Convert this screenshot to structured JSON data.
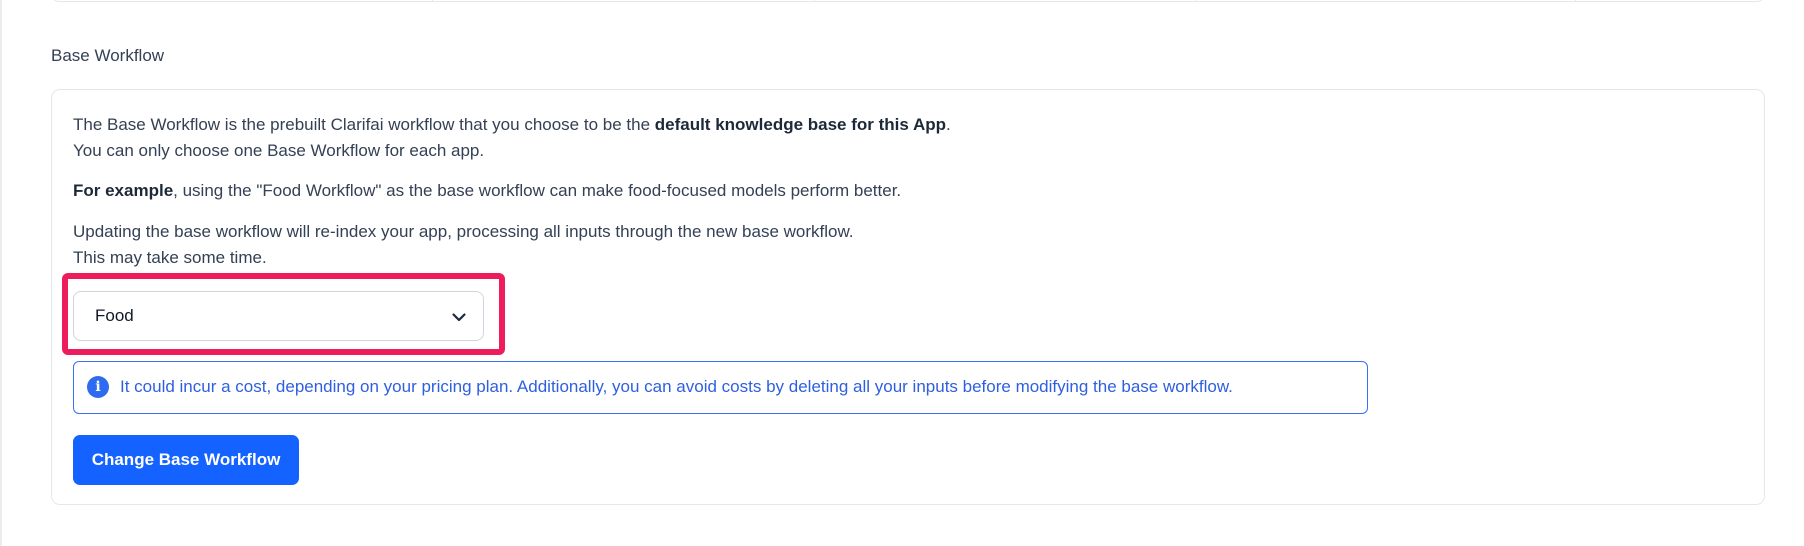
{
  "section": {
    "title": "Base Workflow"
  },
  "description": {
    "line1_prefix": "The Base Workflow is the prebuilt Clarifai workflow that you choose to be the ",
    "line1_bold": "default knowledge base for this App",
    "line1_suffix": ".",
    "line2": "You can only choose one Base Workflow for each app.",
    "example_bold": "For example",
    "example_rest": ", using the \"Food Workflow\" as the base workflow can make food-focused models perform better.",
    "update_line1": "Updating the base workflow will re-index your app, processing all inputs through the new base workflow.",
    "update_line2": "This may take some time."
  },
  "workflow_select": {
    "value": "Food",
    "icon": "chevron-down-icon"
  },
  "info_banner": {
    "icon": "info-icon",
    "icon_glyph": "i",
    "text": "It could incur a cost, depending on your pricing plan. Additionally, you can avoid costs by deleting all your inputs before modifying the base workflow."
  },
  "change_button": {
    "label": "Change Base Workflow"
  },
  "colors": {
    "primary": "#1462ff",
    "info": "#2e5fe0",
    "highlight": "#ed1d5b",
    "border": "#e4e7ec"
  }
}
